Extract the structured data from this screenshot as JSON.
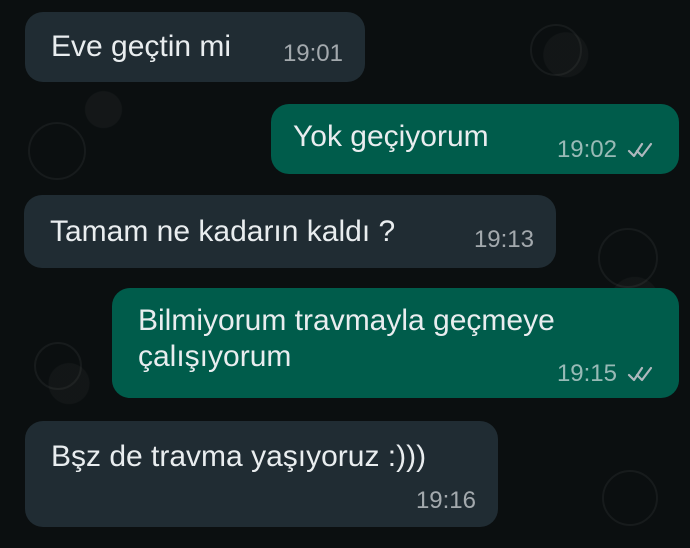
{
  "messages": [
    {
      "text": "Eve geçtin mi",
      "time": "19:01"
    },
    {
      "text": "Yok geçiyorum",
      "time": "19:02",
      "status_icon": "double-check-icon"
    },
    {
      "text": "Tamam ne kadarın kaldı ?",
      "time": "19:13"
    },
    {
      "line1": "Bilmiyorum travmayla geçmeye",
      "line2": "çalışıyorum",
      "time": "19:15",
      "status_icon": "double-check-icon"
    },
    {
      "text": "Bşz de travma yaşıyoruz :)))",
      "time": "19:16"
    }
  ],
  "colors": {
    "background": "#0b0f10",
    "incoming_bubble": "#202c33",
    "outgoing_bubble": "#005c4b",
    "message_text": "#e9edef",
    "meta_text": "#aeb8bd"
  }
}
